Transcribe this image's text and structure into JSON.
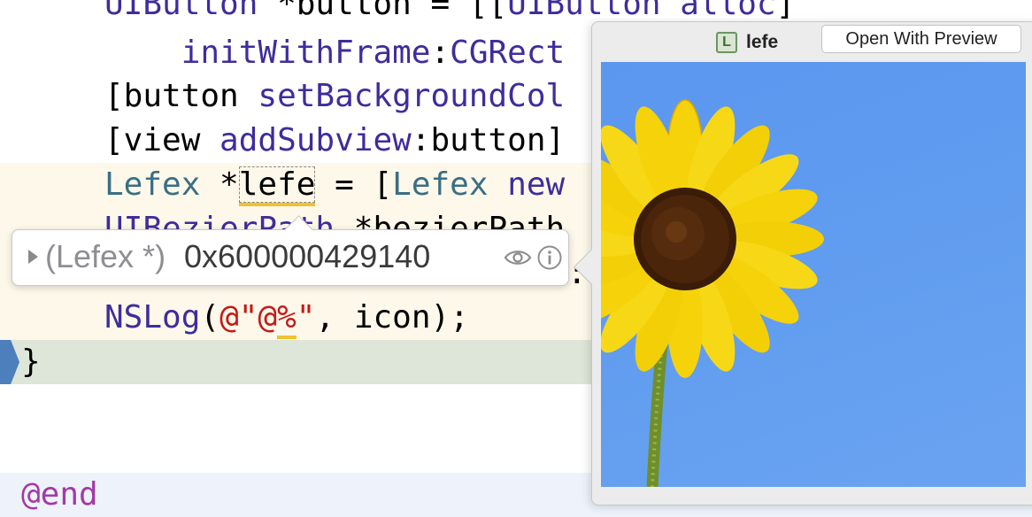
{
  "code": {
    "lines": [
      {
        "a": "UIButton",
        "b": " *button = [[",
        "c": "UIButton",
        "d": " ",
        "e": "alloc",
        "f": "]"
      },
      {
        "a": "    ",
        "b": "initWithFrame",
        "c": ":",
        "d": "CGRect"
      },
      {
        "a": "[button ",
        "b": "setBackgroundCol"
      },
      {
        "a": "[view ",
        "b": "addSubview",
        "c": ":button]"
      },
      {
        "a": "Lefex",
        "b": " *",
        "c": "lefe",
        "d": " = [",
        "e": "Lefex",
        "f": " ",
        "g": "new"
      },
      {
        "a": "UIBezierPath",
        "b": " *bezierPath"
      },
      {
        "a": "NSLog",
        "b": "(",
        "c": "@\"@",
        "d": "%",
        "e": "\"",
        "f": ", icon);"
      },
      {
        "a": "}"
      },
      {
        "a": "@end"
      }
    ]
  },
  "datatip": {
    "type_label": "(Lefex *)",
    "value": "0x600000429140",
    "overflow_text": ":c"
  },
  "quicklook": {
    "title": "lefe",
    "title_icon_letter": "L",
    "open_button_label": "Open With Preview"
  },
  "icons": [
    "disclosure-triangle-icon",
    "eye-icon",
    "info-icon",
    "variable-l-icon"
  ],
  "colors": {
    "highlight_line": "#fdf8ea",
    "current_line": "#dde6d8",
    "execution_marker": "#4d7fbd",
    "image_sky": "#5f9bef",
    "petal": "#f5d20a"
  }
}
